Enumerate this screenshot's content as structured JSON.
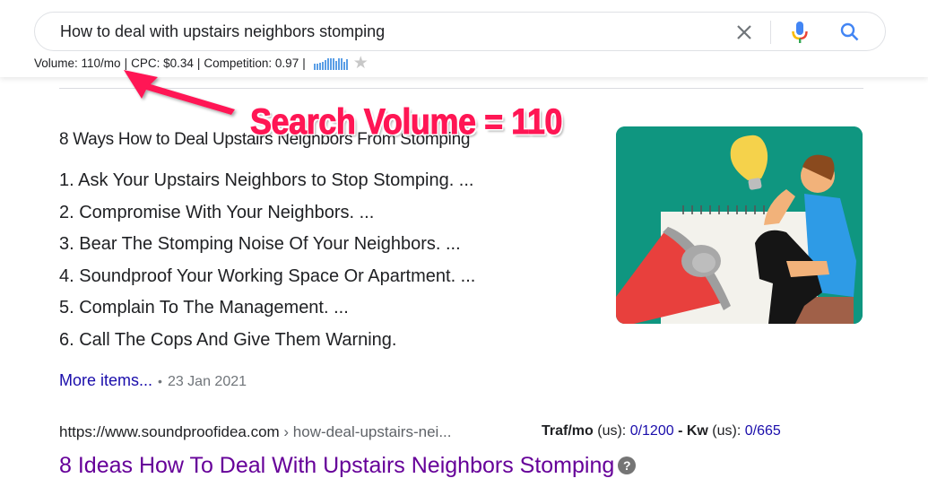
{
  "search": {
    "query": "How to deal with upstairs neighbors stomping",
    "icons": [
      "clear-icon",
      "microphone-icon",
      "search-icon"
    ]
  },
  "keyword_stats": {
    "volume": "Volume: 110/mo",
    "cpc": "CPC: $0.34",
    "competition": "Competition: 0.97",
    "separator": "|",
    "trend_values": [
      0.55,
      0.55,
      0.65,
      0.7,
      0.85,
      1.0,
      1.0,
      1.0,
      0.8,
      1.0,
      1.0,
      0.7,
      0.9
    ],
    "trend_color": "#5a9ee6",
    "favorite_icon": "star-icon"
  },
  "annotation": {
    "label": "Search Volume = 110",
    "color": "#ff1654"
  },
  "featured_snippet": {
    "title": "8 Ways How to Deal Upstairs Neighbors From Stomping",
    "items": [
      "1. Ask Your Upstairs Neighbors to Stop Stomping. ...",
      "2. Compromise With Your Neighbors. ...",
      "3. Bear The Stomping Noise Of Your Neighbors. ...",
      "4. Soundproof Your Working Space Or Apartment. ...",
      "5. Complain To The Management. ...",
      "6. Call The Cops And Give Them Warning."
    ],
    "more_items": "More items...",
    "bullet": "•",
    "date": "23 Jan 2021",
    "image_alt": "illustration-man-thinking-megaphone-lightbulb"
  },
  "result": {
    "url_base": "https://www.soundproofidea.com",
    "url_crumb": " › how-deal-upstairs-nei...",
    "traf_label": "Traf/mo",
    "traf_region": " (us): ",
    "traf_value": "0/1200",
    "dash": " - ",
    "kw_label": "Kw",
    "kw_region": " (us): ",
    "kw_value": "0/665",
    "title": "8 Ideas How To Deal With Upstairs Neighbors Stomping",
    "help": "?"
  },
  "colors": {
    "link": "#1a0dab",
    "visited": "#660099",
    "muted": "#70757a",
    "illustration_bg": "#0f9680"
  }
}
